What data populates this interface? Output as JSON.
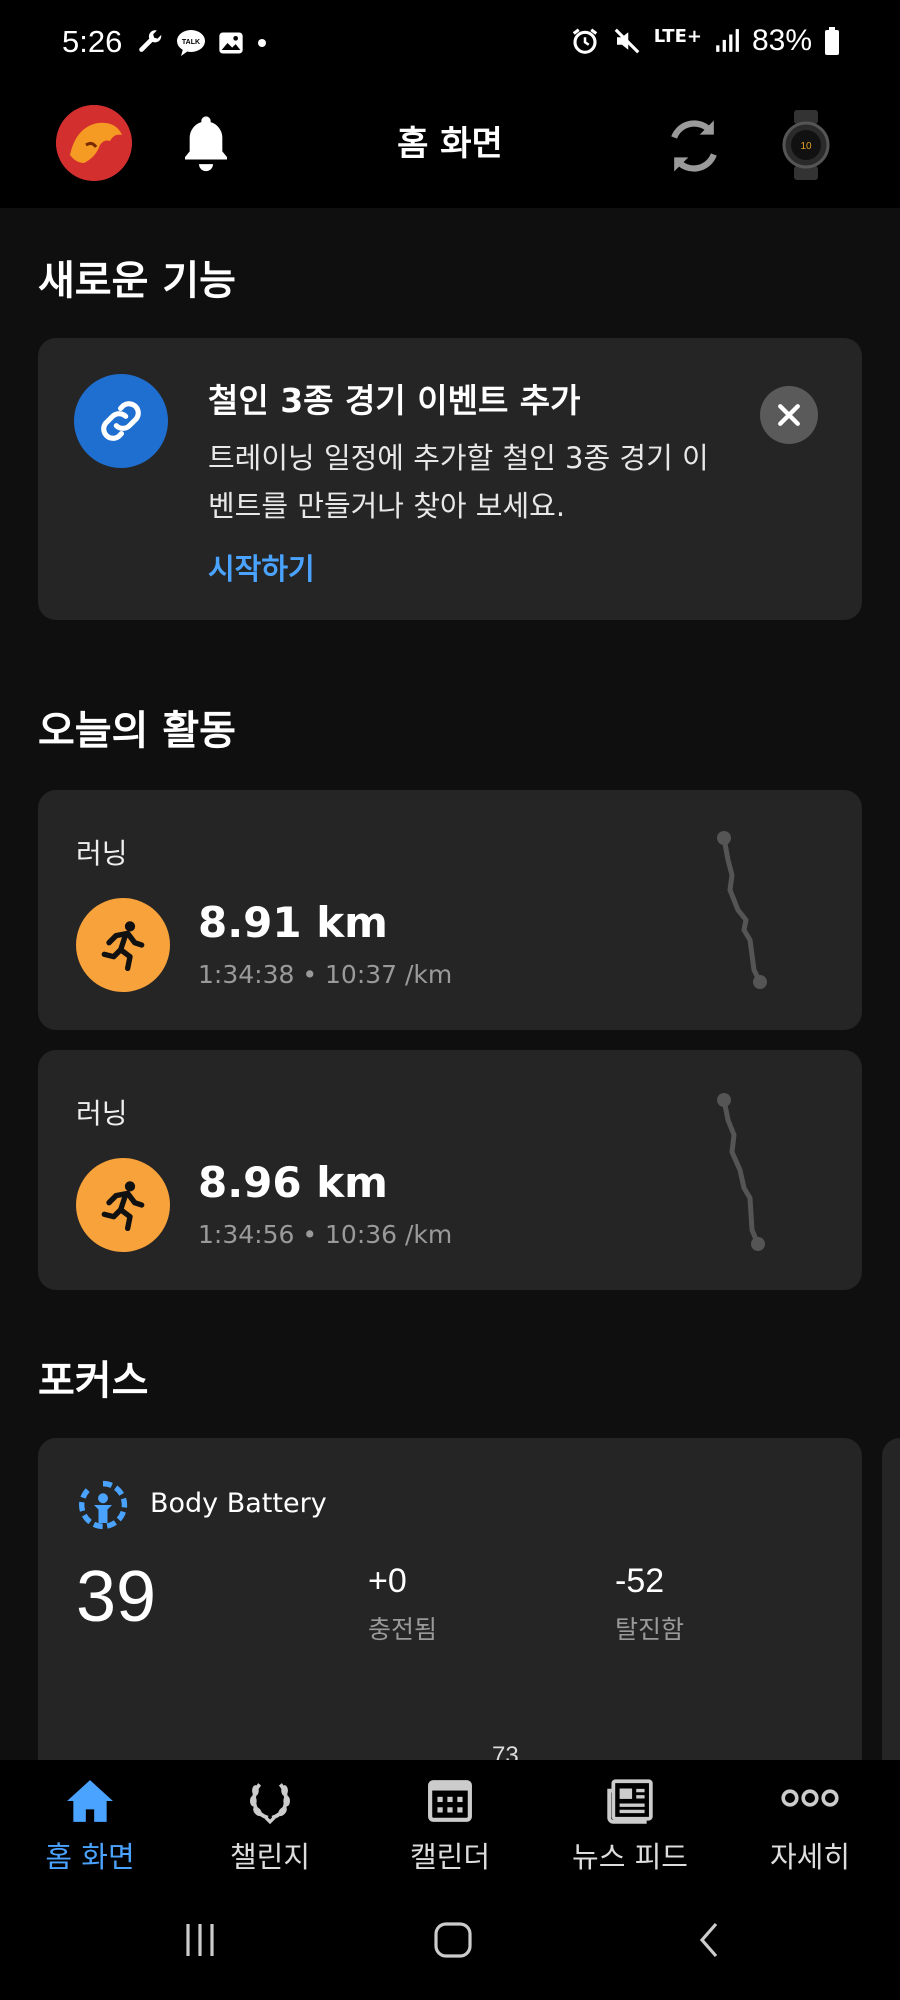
{
  "status_bar": {
    "time": "5:26",
    "network": "LTE+",
    "battery": "83%"
  },
  "header": {
    "title": "홈 화면"
  },
  "whats_new": {
    "section_title": "새로운 기능",
    "card": {
      "title": "철인 3종 경기 이벤트 추가",
      "body": "트레이닝 일정에 추가할 철인 3종 경기 이벤트를 만들거나 찾아 보세요.",
      "link": "시작하기"
    }
  },
  "today": {
    "section_title": "오늘의 활동",
    "activities": [
      {
        "type": "러닝",
        "distance": "8.91 km",
        "meta": "1:34:38 • 10:37 /km",
        "icon": "running-icon"
      },
      {
        "type": "러닝",
        "distance": "8.96 km",
        "meta": "1:34:56 • 10:36 /km",
        "icon": "running-icon"
      }
    ]
  },
  "focus": {
    "section_title": "포커스",
    "body_battery": {
      "label": "Body Battery",
      "value": "39",
      "charged_value": "+0",
      "charged_label": "충전됨",
      "drained_value": "-52",
      "drained_label": "탈진함",
      "chart_top_label": "73"
    }
  },
  "bottom_nav": [
    {
      "label": "홈 화면",
      "icon": "home-icon",
      "active": true
    },
    {
      "label": "챌린지",
      "icon": "laurel-icon",
      "active": false
    },
    {
      "label": "캘린더",
      "icon": "calendar-icon",
      "active": false
    },
    {
      "label": "뉴스 피드",
      "icon": "newspaper-icon",
      "active": false
    },
    {
      "label": "자세히",
      "icon": "more-icon",
      "active": false
    }
  ],
  "colors": {
    "accent_blue": "#4aa3ff",
    "activity_orange": "#f7a23b",
    "card_bg": "#252525",
    "feature_icon_bg": "#1f6fd1"
  }
}
